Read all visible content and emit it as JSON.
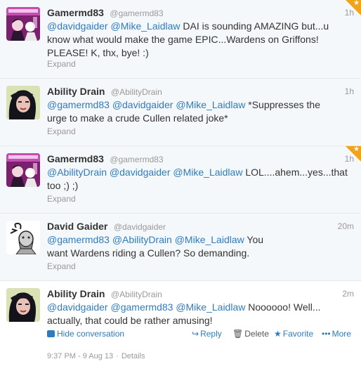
{
  "tweets": [
    {
      "fullname": "Gamermd83",
      "username": "@gamermd83",
      "time": "1h",
      "body": [
        {
          "t": "@davidgaider",
          "m": true
        },
        {
          "t": " ",
          "m": false
        },
        {
          "t": "@Mike_Laidlaw",
          "m": true
        },
        {
          "t": " DAI is sounding AMAZING but...u know what would make the game EPIC...Wardens on Griffons! PLEASE! K, thx, bye! :)",
          "m": false
        }
      ],
      "expand": "Expand",
      "favorited": true
    },
    {
      "fullname": "Ability Drain",
      "username": "@AbilityDrain",
      "time": "1h",
      "body": [
        {
          "t": "@gamermd83",
          "m": true
        },
        {
          "t": " ",
          "m": false
        },
        {
          "t": "@davidgaider",
          "m": true
        },
        {
          "t": " ",
          "m": false
        },
        {
          "t": "@Mike_Laidlaw",
          "m": true
        },
        {
          "t": " *Suppresses the urge to make a crude Cullen related joke*",
          "m": false
        }
      ],
      "expand": "Expand",
      "favorited": false
    },
    {
      "fullname": "Gamermd83",
      "username": "@gamermd83",
      "time": "1h",
      "body": [
        {
          "t": "@AbilityDrain",
          "m": true
        },
        {
          "t": " ",
          "m": false
        },
        {
          "t": "@davidgaider",
          "m": true
        },
        {
          "t": " ",
          "m": false
        },
        {
          "t": "@Mike_Laidlaw",
          "m": true
        },
        {
          "t": " LOL....ahem...yes...that too ;) ;)",
          "m": false
        }
      ],
      "expand": "Expand",
      "favorited": true
    },
    {
      "fullname": "David Gaider",
      "username": "@davidgaider",
      "time": "20m",
      "body": [
        {
          "t": "@gamermd83",
          "m": true
        },
        {
          "t": " ",
          "m": false
        },
        {
          "t": "@AbilityDrain",
          "m": true
        },
        {
          "t": " ",
          "m": false
        },
        {
          "t": "@Mike_Laidlaw",
          "m": true
        },
        {
          "t": " You want Wardens riding a Cullen? So demanding.",
          "m": false
        }
      ],
      "expand": "Expand",
      "favorited": false
    },
    {
      "fullname": "Ability Drain",
      "username": "@AbilityDrain",
      "time": "2m",
      "body": [
        {
          "t": "@davidgaider",
          "m": true
        },
        {
          "t": " ",
          "m": false
        },
        {
          "t": "@gamermd83",
          "m": true
        },
        {
          "t": " ",
          "m": false
        },
        {
          "t": "@Mike_Laidlaw",
          "m": true
        },
        {
          "t": " Noooooo! Well... actually, that could be rather amusing!",
          "m": false
        }
      ],
      "favorited": false
    }
  ],
  "actions": {
    "hide": "Hide conversation",
    "reply": "Reply",
    "delete": "Delete",
    "favorite": "Favorite",
    "more": "More",
    "reply_glyph": "↪",
    "delete_glyph": "🗑",
    "favorite_glyph": "★",
    "more_glyph": "•••"
  },
  "meta": {
    "timestamp": "9:37 PM - 9 Aug 13",
    "separator": "·",
    "details": "Details"
  },
  "colors": {
    "link": "#2f7bbd",
    "favorite_corner": "#f3a317",
    "collapsed_bg": "#f5f8fa",
    "divider": "#e8e8e8"
  },
  "icons": {
    "gamer_avatar": "gamer-avatar-icon",
    "ability_avatar": "ability-drain-avatar-icon",
    "gaider_avatar": "david-gaider-avatar-icon"
  }
}
